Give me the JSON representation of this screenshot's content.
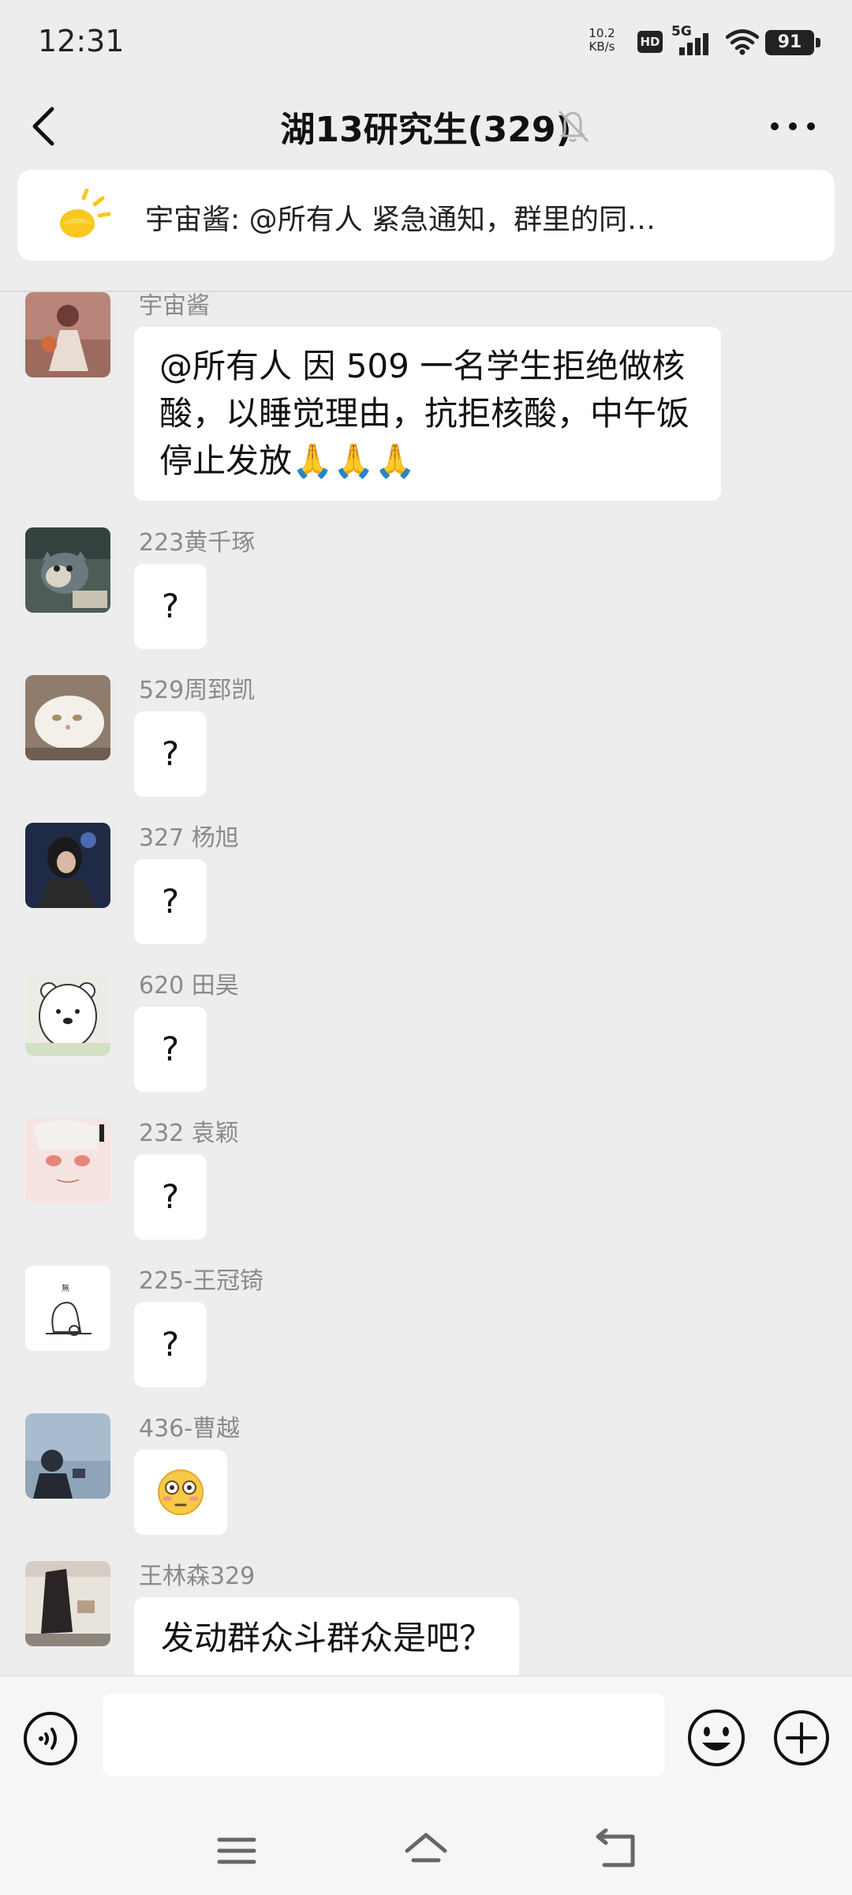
{
  "status_bar": {
    "time": "12:31",
    "net_speed_value": "10.2",
    "net_speed_unit": "KB/s",
    "hd_label": "HD",
    "network_label": "5G",
    "battery_level": "91"
  },
  "header": {
    "title": "湖13研究生(329)",
    "back_icon": "chevron-left-icon",
    "mute_icon": "bell-off-icon",
    "more_icon": "more-dots-icon"
  },
  "notice": {
    "icon": "sun-megaphone-icon",
    "text": "宇宙酱: @所有人 紧急通知，群里的同…"
  },
  "messages": [
    {
      "sender": "宇宙酱",
      "text": "@所有人  因 509 一名学生拒绝做核酸，以睡觉理由，抗拒核酸，中午饭停止发放🙏🙏🙏"
    },
    {
      "sender": "223黄千琢",
      "text": "?"
    },
    {
      "sender": "529周郅凯",
      "text": "?"
    },
    {
      "sender": "327 杨旭",
      "text": "?"
    },
    {
      "sender": "620 田昊",
      "text": "?"
    },
    {
      "sender": "232 袁颖",
      "text": "?"
    },
    {
      "sender": "225-王冠锜",
      "text": "?"
    },
    {
      "sender": "436-曹越",
      "text": "",
      "emoji": "flushed-face-emoji"
    },
    {
      "sender": "王林森329",
      "text": "发动群众斗群众是吧？"
    }
  ],
  "input_bar": {
    "voice_icon": "voice-icon",
    "emoji_icon": "smiley-icon",
    "plus_icon": "plus-circle-icon",
    "input_value": ""
  },
  "nav_bar": {
    "menu_icon": "menu-icon",
    "home_icon": "home-icon",
    "back_icon": "back-arrow-icon"
  }
}
